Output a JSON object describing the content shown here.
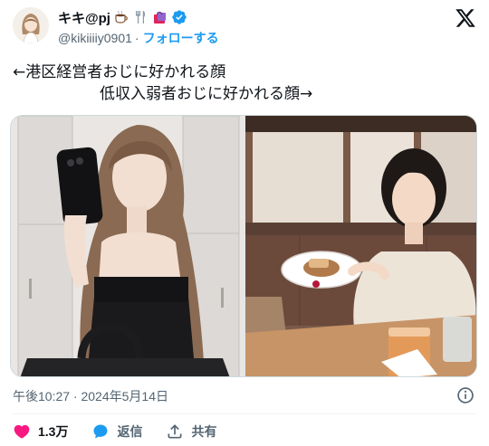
{
  "author": {
    "display_name": "キキ@pj",
    "handle": "@kikiiiiy0901",
    "separator": "·",
    "follow_label": "フォローする"
  },
  "tweet": {
    "line1": "←港区経営者おじに好かれる顔",
    "line2": "低収入弱者おじに好かれる顔→"
  },
  "meta": {
    "timestamp": "午後10:27 · 2024年5月14日"
  },
  "actions": {
    "like_count": "1.3万",
    "reply_label": "返信",
    "share_label": "共有"
  },
  "colors": {
    "accent": "#1d9bf0",
    "like": "#f91880",
    "text": "#0f1419",
    "secondary": "#536471"
  },
  "icons": [
    "x-logo-icon",
    "verified-badge-icon",
    "coffee-emoji-icon",
    "cutlery-emoji-icon",
    "shopping-bag-emoji-icon",
    "info-icon",
    "heart-icon",
    "reply-bubble-icon",
    "share-icon"
  ]
}
